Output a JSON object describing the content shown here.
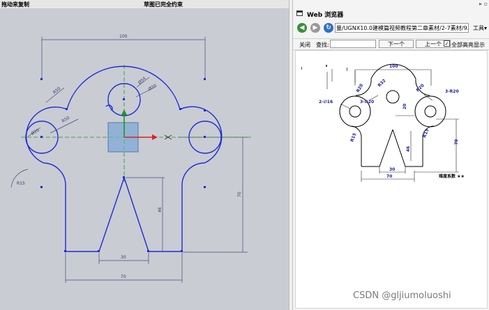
{
  "sketch": {
    "status_left": "拖动来复制",
    "status_center": "草图已完全约束",
    "dims": {
      "width_top": "100",
      "r_left": "R50",
      "r_top": "R50",
      "r_big": "Ø54",
      "d_small": "Ø20",
      "d_left": "Ø20",
      "r_corner": "R15",
      "h_right": "70",
      "h_inner": "46",
      "w_bottom_inner": "30",
      "w_bottom": "70"
    }
  },
  "web_browser": {
    "title": "Web 浏览器",
    "url": "量/UGNX10.0建模篇视频教程第二章素材/2-7素材/9.jpg",
    "tools_menu": "工具",
    "find_bar": {
      "close_label": "关闭",
      "find_label": "查找:",
      "next_button": "下一个",
      "prev_button": "上一个",
      "highlight_label": "全部高亮显示",
      "highlight_checked": true
    },
    "drawing": {
      "dim_100": "100",
      "dim_r20_a": "R20",
      "dim_r32": "R32",
      "dim_r20_b": "R20",
      "dim_3r20": "3-R20",
      "dim_2d16": "2-∅16",
      "dim_3d20": "3-∅20",
      "dim_20": "20",
      "dim_r15_a": "R15",
      "dim_r15_b": "R15",
      "dim_46": "46",
      "dim_70_right": "70",
      "dim_30": "30",
      "dim_70_bottom": "70",
      "difficulty": "难度系数 ★★"
    }
  },
  "watermark": "CSDN @gljiumoluoshi",
  "colors": {
    "sketch_curve": "#1f2bd4",
    "dim_line": "#4a4a7a",
    "canvas_bg": "#c9ccd3",
    "axis_x": "#e02020",
    "axis_y": "#1a9a1a"
  }
}
